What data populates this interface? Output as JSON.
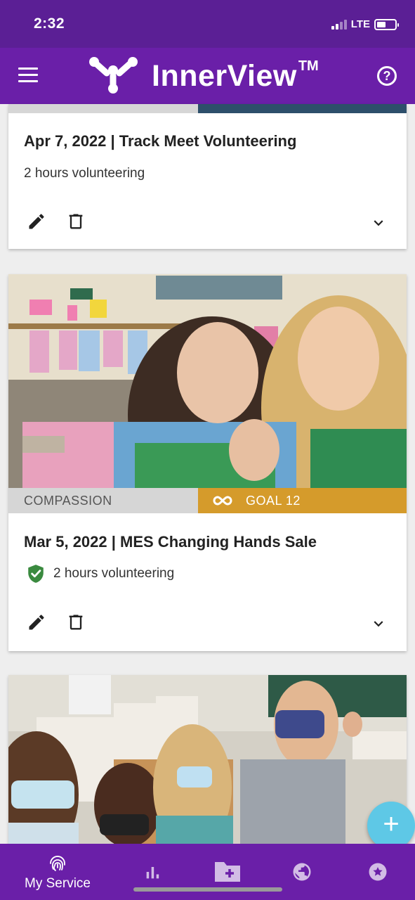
{
  "status_bar": {
    "time": "2:32",
    "network": "LTE",
    "battery_level": 0.5
  },
  "app_bar": {
    "logo_text": "InnerView",
    "logo_tm": "TM",
    "menu_icon": "hamburger-menu-icon",
    "help_icon": "help-circle-icon"
  },
  "entries": [
    {
      "title": "Apr 7, 2022 | Track Meet Volunteering",
      "hours": "2 hours volunteering",
      "verified": false,
      "actions": [
        "edit-icon",
        "delete-icon",
        "expand-icon"
      ]
    },
    {
      "title": "Mar 5, 2022 | MES Changing Hands Sale",
      "hours": "2 hours volunteering",
      "verified": true,
      "category": "COMPASSION",
      "goal": "GOAL 12",
      "actions": [
        "edit-icon",
        "delete-icon",
        "expand-icon"
      ]
    }
  ],
  "fab": {
    "icon": "plus-icon"
  },
  "bottom_nav": {
    "items": [
      {
        "label": "My Service",
        "icon": "fingerprint-icon",
        "active": true
      },
      {
        "label": "",
        "icon": "bar-chart-icon"
      },
      {
        "label": "",
        "icon": "folder-add-icon"
      },
      {
        "label": "",
        "icon": "globe-icon"
      },
      {
        "label": "",
        "icon": "star-badge-icon"
      }
    ]
  },
  "colors": {
    "primary": "#6a1fa8",
    "status_bar": "#5b1f95",
    "goal_tag": "#d59b2b",
    "fab": "#5ec8e6",
    "verified": "#3a8a3f"
  }
}
